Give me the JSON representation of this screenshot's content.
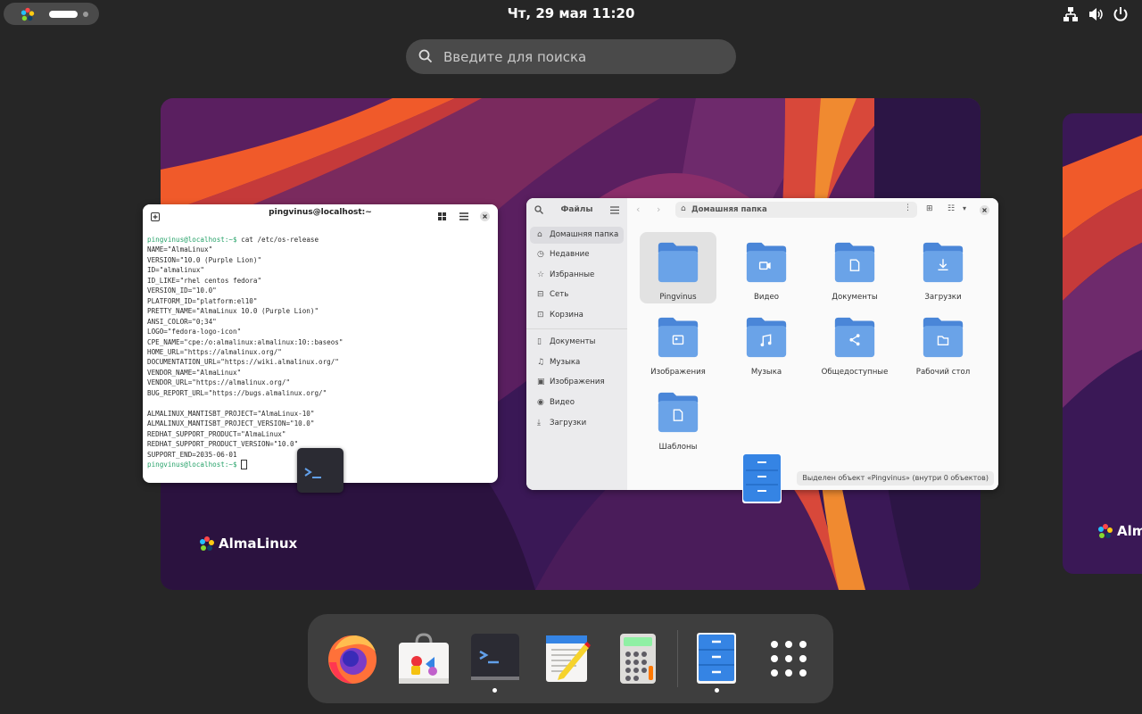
{
  "topbar": {
    "clock": "Чт, 29 мая  11:20",
    "tray_icons": [
      "network-icon",
      "volume-icon",
      "power-icon"
    ]
  },
  "search": {
    "placeholder": "Введите для поиска"
  },
  "workspace": {
    "brand": "AlmaLinux",
    "brand_partial": "Alm"
  },
  "terminal": {
    "title": "pingvinus@localhost:~",
    "prompt": "pingvinus@localhost:~$",
    "command": " cat /etc/os-release",
    "output": [
      "NAME=\"AlmaLinux\"",
      "VERSION=\"10.0 (Purple Lion)\"",
      "ID=\"almalinux\"",
      "ID_LIKE=\"rhel centos fedora\"",
      "VERSION_ID=\"10.0\"",
      "PLATFORM_ID=\"platform:el10\"",
      "PRETTY_NAME=\"AlmaLinux 10.0 (Purple Lion)\"",
      "ANSI_COLOR=\"0;34\"",
      "LOGO=\"fedora-logo-icon\"",
      "CPE_NAME=\"cpe:/o:almalinux:almalinux:10::baseos\"",
      "HOME_URL=\"https://almalinux.org/\"",
      "DOCUMENTATION_URL=\"https://wiki.almalinux.org/\"",
      "VENDOR_NAME=\"AlmaLinux\"",
      "VENDOR_URL=\"https://almalinux.org/\"",
      "BUG_REPORT_URL=\"https://bugs.almalinux.org/\"",
      "",
      "ALMALINUX_MANTISBT_PROJECT=\"AlmaLinux-10\"",
      "ALMALINUX_MANTISBT_PROJECT_VERSION=\"10.0\"",
      "REDHAT_SUPPORT_PRODUCT=\"AlmaLinux\"",
      "REDHAT_SUPPORT_PRODUCT_VERSION=\"10.0\"",
      "SUPPORT_END=2035-06-01"
    ]
  },
  "files": {
    "sidebar_title": "Файлы",
    "path": "Домашняя папка",
    "sidebar": [
      {
        "label": "Домашняя папка",
        "icon": "home-icon"
      },
      {
        "label": "Недавние",
        "icon": "clock-icon"
      },
      {
        "label": "Избранные",
        "icon": "star-icon"
      },
      {
        "label": "Сеть",
        "icon": "network-icon"
      },
      {
        "label": "Корзина",
        "icon": "trash-icon"
      },
      {
        "label": "Документы",
        "icon": "document-icon"
      },
      {
        "label": "Музыка",
        "icon": "music-icon"
      },
      {
        "label": "Изображения",
        "icon": "image-icon"
      },
      {
        "label": "Видео",
        "icon": "video-icon"
      },
      {
        "label": "Загрузки",
        "icon": "download-icon"
      }
    ],
    "folders": [
      {
        "label": "Pingvinus",
        "emblem": ""
      },
      {
        "label": "Видео",
        "emblem": "video"
      },
      {
        "label": "Документы",
        "emblem": "doc"
      },
      {
        "label": "Загрузки",
        "emblem": "download"
      },
      {
        "label": "Изображения",
        "emblem": "image"
      },
      {
        "label": "Музыка",
        "emblem": "music"
      },
      {
        "label": "Общедоступные",
        "emblem": "share"
      },
      {
        "label": "Рабочий стол",
        "emblem": "desktop"
      },
      {
        "label": "Шаблоны",
        "emblem": "doc"
      }
    ],
    "status": "Выделен объект «Pingvinus» (внутри 0 объектов)"
  },
  "dock": {
    "apps": [
      "firefox-icon",
      "software-center-icon",
      "terminal-icon",
      "text-editor-icon",
      "calculator-icon",
      "files-icon",
      "app-grid-icon"
    ]
  },
  "colors": {
    "folder": "#6aa3e8",
    "folder_dark": "#4a86d8",
    "prompt": "#26a269"
  }
}
